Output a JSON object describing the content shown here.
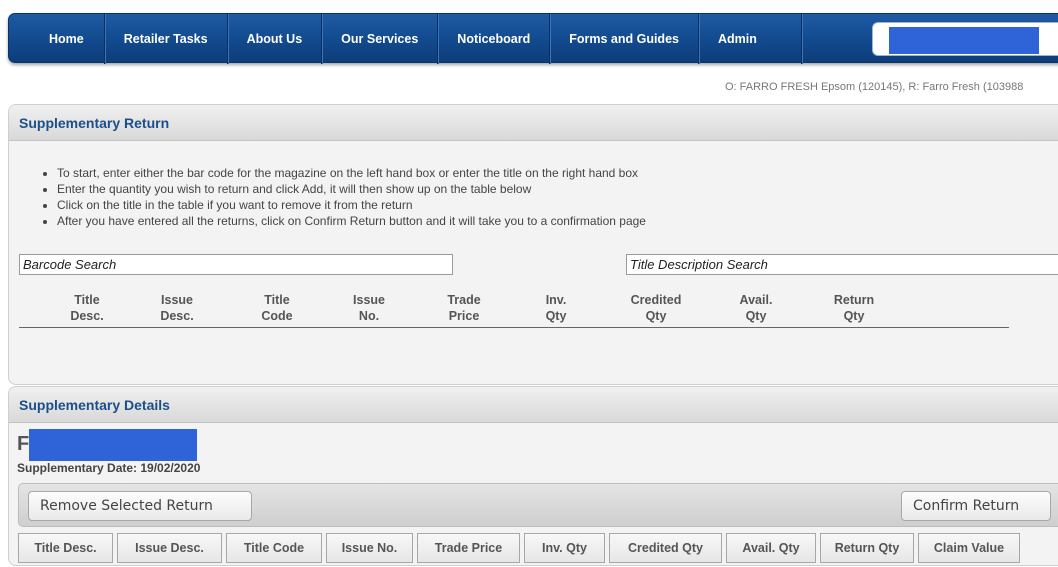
{
  "nav": {
    "items": [
      {
        "label": "Home",
        "id": "home"
      },
      {
        "label": "Retailer Tasks",
        "id": "retailer-tasks"
      },
      {
        "label": "About Us",
        "id": "about-us"
      },
      {
        "label": "Our Services",
        "id": "our-services"
      },
      {
        "label": "Noticeboard",
        "id": "noticeboard"
      },
      {
        "label": "Forms and Guides",
        "id": "forms-and-guides"
      },
      {
        "label": "Admin",
        "id": "admin"
      }
    ]
  },
  "org_line": "O: FARRO FRESH Epsom (120145), R: Farro Fresh (103988",
  "supplementary_return": {
    "title": "Supplementary Return",
    "instructions": [
      "To start, enter either the bar code for the magazine on the left hand box or enter the title on the right hand box",
      "Enter the quantity you wish to return and click Add, it will then show up on the table below",
      "Click on the title in the table if you want to remove it from the return",
      "After you have entered all the returns, click on Confirm Return button and it will take you to a confirmation page"
    ],
    "barcode_placeholder": "Barcode Search",
    "title_placeholder": "Title Description Search",
    "columns": [
      [
        "Title",
        "Desc."
      ],
      [
        "Issue",
        "Desc."
      ],
      [
        "Title",
        "Code"
      ],
      [
        "Issue",
        "No."
      ],
      [
        "Trade",
        "Price"
      ],
      [
        "Inv.",
        "Qty"
      ],
      [
        "Credited",
        "Qty"
      ],
      [
        "Avail.",
        "Qty"
      ],
      [
        "Return",
        "Qty"
      ]
    ]
  },
  "supplementary_details": {
    "title": "Supplementary Details",
    "name_initial": "F",
    "date_label": "Supplementary Date:",
    "date_value": "19/02/2020",
    "remove_label": "Remove Selected Return",
    "confirm_label": "Confirm Return",
    "columns": [
      "Title Desc.",
      "Issue Desc.",
      "Title Code",
      "Issue No.",
      "Trade Price",
      "Inv. Qty",
      "Credited Qty",
      "Avail. Qty",
      "Return Qty",
      "Claim Value"
    ]
  }
}
